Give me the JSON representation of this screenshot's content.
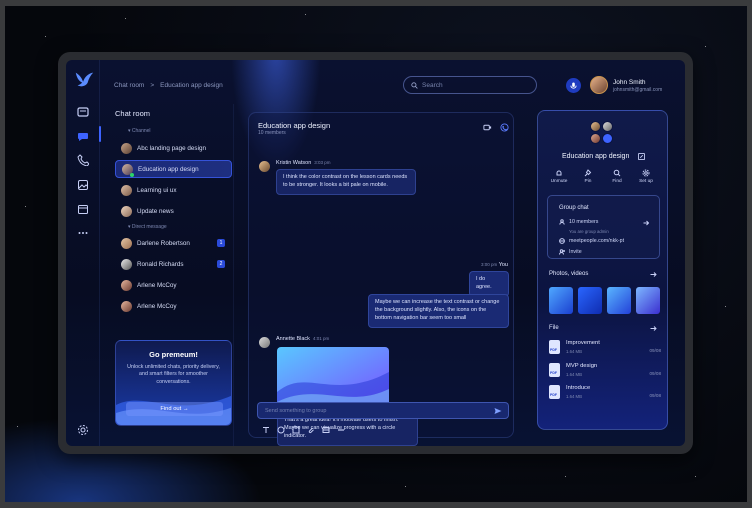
{
  "colors": {
    "accent": "#3d63ff",
    "panel": "#0c1440",
    "online": "#2bd46b"
  },
  "breadcrumb": {
    "root": "Chat room",
    "separator": ">",
    "current": "Education app design"
  },
  "search": {
    "placeholder": "Search",
    "icon": "search-icon"
  },
  "user": {
    "name": "John Smith",
    "email": "johnsmith@gmail.com"
  },
  "rail": {
    "icons": [
      "chat-bubbles-icon",
      "chat-icon",
      "phone-icon",
      "image-icon",
      "calendar-icon",
      "more-icon",
      "settings-icon"
    ]
  },
  "sidebar": {
    "title": "Chat room",
    "channel_label": "Channel",
    "channels": [
      {
        "label": "Abc landing page design"
      },
      {
        "label": "Education app design"
      },
      {
        "label": "Learning ui ux"
      },
      {
        "label": "Update news"
      }
    ],
    "direct_label": "Direct message",
    "direct": [
      {
        "label": "Darlene Robertson",
        "badge": "1"
      },
      {
        "label": "Ronald Richards",
        "badge": "2"
      },
      {
        "label": "Arlene McCoy",
        "badge": ""
      },
      {
        "label": "Arlene McCoy",
        "badge": ""
      }
    ]
  },
  "promo": {
    "title": "Go premeum!",
    "text": "Unlock unlimited chats, priority delivery, and smart filters for smoother conversations.",
    "button": "Find out →"
  },
  "chat": {
    "title": "Education app design",
    "members": "10 members",
    "messages": [
      {
        "author": "Kristin Watson",
        "time": "3:03 pm",
        "text": "I think the color contrast on the lesson cards needs to be stronger. It looks a bit pale on mobile."
      },
      {
        "author": "You",
        "time": "3:00 pm",
        "text": "I do agree."
      },
      {
        "author": "You",
        "time": "",
        "text": "Maybe we can increase the text contrast or change the background slightly. Also, the icons on the bottom navigation bar seem too small"
      },
      {
        "author": "Annette Black",
        "time": "4:01 pm",
        "text": "That's a great idea! It'll motivate users to finish. Maybe we can visualize progress with a circle indicator."
      }
    ],
    "composer_placeholder": "Send something to group"
  },
  "info": {
    "group_name": "Education app design",
    "actions": [
      {
        "label": "Unmute"
      },
      {
        "label": "Pin"
      },
      {
        "label": "Find"
      },
      {
        "label": "Set up"
      }
    ],
    "group_chat": {
      "title": "Group chat",
      "members": "10 members",
      "admin_note": "You are group admin",
      "link": "meetpeople.com/nkk-pt",
      "invite": "Invite"
    },
    "photos_title": "Photos, videos",
    "file_title": "File",
    "files": [
      {
        "name": "Improvement",
        "size": "1.64 MB",
        "date": "09/08"
      },
      {
        "name": "MVP design",
        "size": "1.64 MB",
        "date": "09/08"
      },
      {
        "name": "Introduce",
        "size": "1.64 MB",
        "date": "09/08"
      }
    ]
  }
}
